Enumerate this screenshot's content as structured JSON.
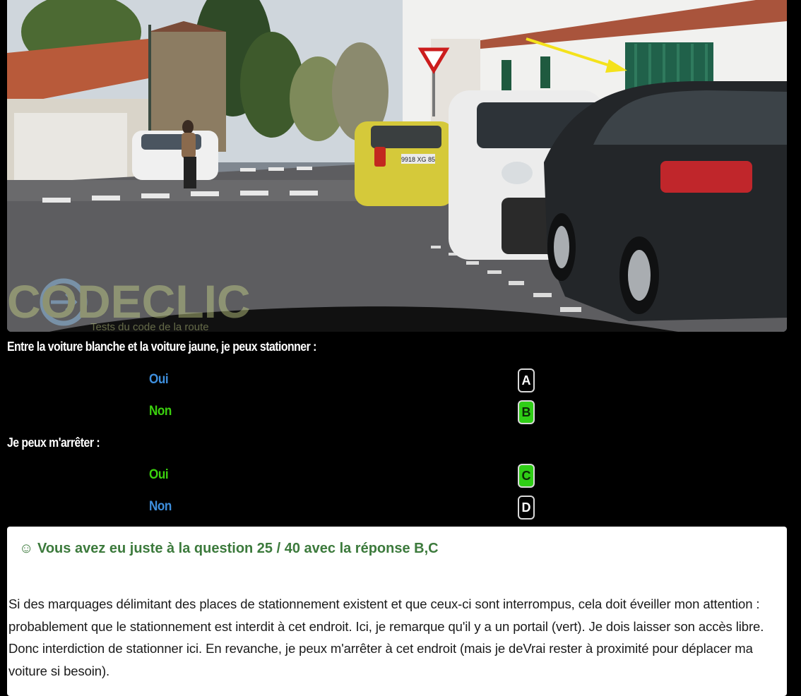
{
  "photo": {
    "watermark_brand": "CODECLIC",
    "watermark_tagline": "Tests du code de la route",
    "plate_yellow": "9918 XG 85"
  },
  "questions": [
    {
      "text": "Entre la voiture blanche et la voiture jaune, je peux stationner :",
      "answers": [
        {
          "label": "Oui",
          "letter": "A",
          "correct": false
        },
        {
          "label": "Non",
          "letter": "B",
          "correct": true
        }
      ]
    },
    {
      "text": "Je peux m'arrêter :",
      "answers": [
        {
          "label": "Oui",
          "letter": "C",
          "correct": true
        },
        {
          "label": "Non",
          "letter": "D",
          "correct": false
        }
      ]
    }
  ],
  "result": {
    "headline": "☺ Vous avez eu juste à la question 25 / 40 avec la réponse B,C",
    "explanation": "Si des marquages délimitant des places de stationnement existent et que ceux-ci sont interrompus, cela doit éveiller mon attention : probablement que le stationnement est interdit à cet endroit. Ici, je remarque qu'il y a un portail (vert). Je dois laisser son accès libre. Donc interdiction de stationner ici. En revanche, je peux m'arrêter à cet endroit (mais je deVrai rester à proximité pour déplacer ma voiture si besoin)."
  },
  "colors": {
    "correct_label": "#3bd10e",
    "incorrect_label": "#3e8fdd",
    "correct_badge": "#2fce16",
    "result_headline": "#3c7a3c"
  }
}
